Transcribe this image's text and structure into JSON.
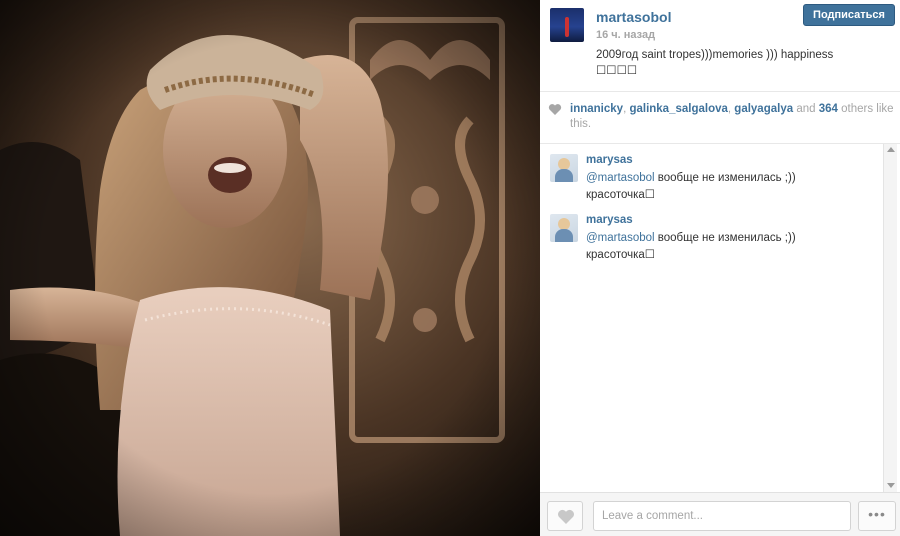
{
  "post": {
    "username": "martasobol",
    "time": "16 ч. назад",
    "caption": "2009год saint tropes)))memories ))) happiness",
    "emoji": "☐☐☐☐",
    "follow_label": "Подписаться"
  },
  "likes": {
    "users": [
      "innanicky",
      "galinka_salgalova",
      "galyagalya"
    ],
    "and": "and",
    "count": "364",
    "suffix": "others like this.",
    "sep": ", "
  },
  "comments": [
    {
      "user": "marysas",
      "mention": "@martasobol",
      "text": "вообще не изменилась ;))",
      "line2": "красоточка☐"
    },
    {
      "user": "marysas",
      "mention": "@martasobol",
      "text": "вообще не изменилась ;))",
      "line2": "красоточка☐"
    }
  ],
  "footer": {
    "comment_placeholder": "Leave a comment...",
    "more_label": "•••"
  },
  "icons": {
    "heart": "heart-icon",
    "like": "like-heart-icon",
    "more": "more-dots-icon"
  },
  "colors": {
    "accent": "#3f729b",
    "muted": "#a6a6a6"
  }
}
